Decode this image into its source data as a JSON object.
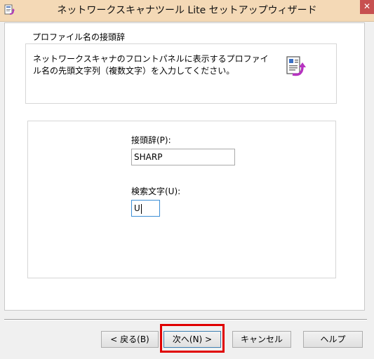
{
  "window": {
    "title": "ネットワークスキャナツール Lite セットアップウィザード",
    "close_glyph": "✕"
  },
  "group": {
    "legend": "プロファイル名の接頭辞",
    "description": "ネットワークスキャナのフロントパネルに表示するプロファイル名の先頭文字列（複数文字）を入力してください。"
  },
  "fields": {
    "prefix_label": "接頭辞(P):",
    "prefix_value": "SHARP",
    "search_label": "検索文字(U):",
    "search_value": "U"
  },
  "buttons": {
    "back": "< 戻る(B)",
    "next": "次へ(N) >",
    "cancel": "キャンセル",
    "help": "ヘルプ"
  },
  "icons": {
    "app": "setup-wizard-icon",
    "wizard": "document-arrow-icon",
    "close": "close-icon"
  },
  "colors": {
    "titlebar": "#f4d9b6",
    "close_button": "#c75050",
    "highlight": "#e00000",
    "focus_border": "#3c8ed6"
  }
}
